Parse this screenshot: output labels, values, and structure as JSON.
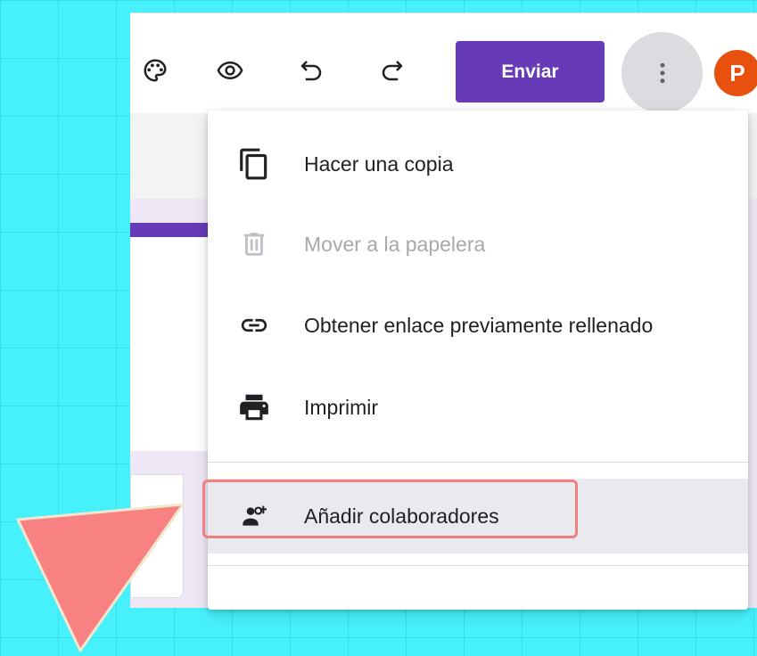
{
  "toolbar": {
    "icons": [
      "palette-icon",
      "eye-preview-icon",
      "undo-icon",
      "redo-icon",
      "more-vert-icon"
    ],
    "send_label": "Enviar",
    "avatar_initial": "P"
  },
  "menu": {
    "items": [
      {
        "label": "Hacer una copia",
        "icon": "copy-icon",
        "enabled": true
      },
      {
        "label": "Mover a la papelera",
        "icon": "trash-icon",
        "enabled": false
      },
      {
        "label": "Obtener enlace previamente rellenado",
        "icon": "link-icon",
        "enabled": true
      },
      {
        "label": "Imprimir",
        "icon": "print-icon",
        "enabled": true
      },
      {
        "label": "Añadir colaboradores",
        "icon": "add-people-icon",
        "enabled": true,
        "highlighted": true
      }
    ]
  },
  "colors": {
    "background": "#47f1fb",
    "accent": "#673ab7",
    "avatar": "#e8500e",
    "callout": "#f08080",
    "pointer_arrow": "#f88282"
  }
}
